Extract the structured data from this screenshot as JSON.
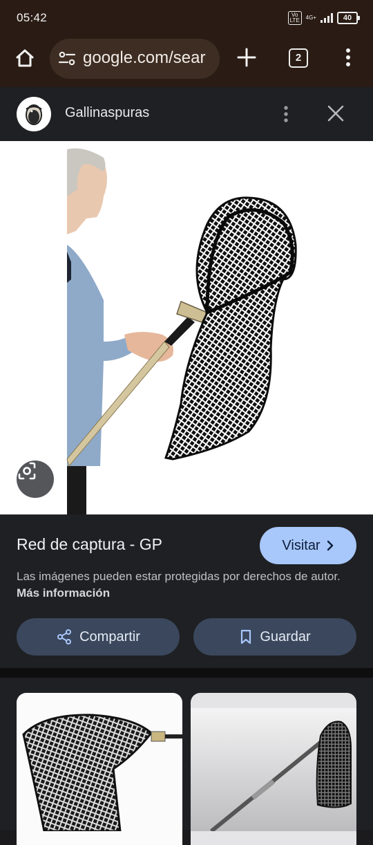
{
  "status_bar": {
    "time": "05:42",
    "volte": "VoLTE",
    "network": "4G+",
    "battery": "40"
  },
  "browser": {
    "url": "google.com/sear",
    "tab_count": "2",
    "icons": [
      "home-icon",
      "site-settings-icon",
      "plus-icon",
      "tab-switcher-icon",
      "more-vert-icon"
    ]
  },
  "source": {
    "name": "Gallinaspuras",
    "icons": [
      "more-vert-icon",
      "close-icon"
    ]
  },
  "image_viewer": {
    "lens_icon": "google-lens-icon"
  },
  "result": {
    "title": "Red de captura - GP",
    "visit_label": "Visitar",
    "copyright_notice": "Las imágenes pueden estar protegidas por derechos de autor.",
    "more_info_link": "Más información",
    "share_label": "Compartir",
    "save_label": "Guardar"
  },
  "colors": {
    "chrome_bg": "#2a1c14",
    "urlbar_bg": "#3e2d22",
    "panel_bg": "#1f2023",
    "visit_bg": "#a8c7fa",
    "pill_bg": "#3a475c"
  }
}
